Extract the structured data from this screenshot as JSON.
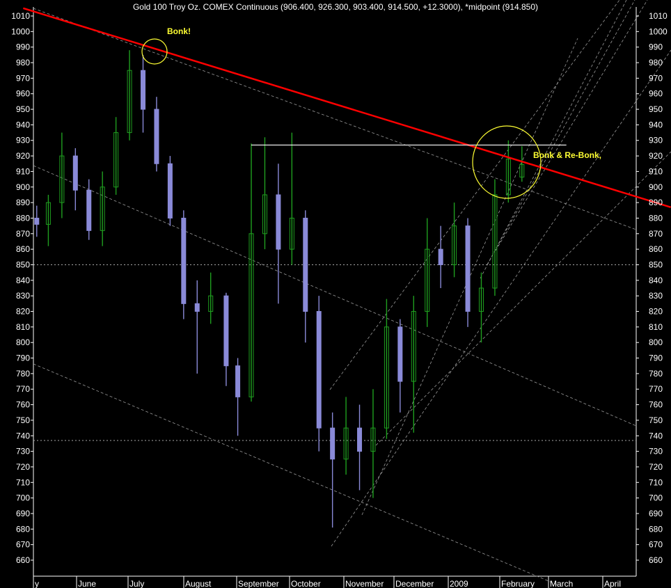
{
  "chart_data": {
    "type": "candlestick",
    "title": "Gold 100 Troy Oz. COMEX Continuous (906.400, 926.300, 903.400, 914.500, +12.3000), *midpoint (914.850)",
    "ylim": [
      655,
      1015
    ],
    "y_ticks": [
      660,
      670,
      680,
      690,
      700,
      710,
      720,
      730,
      740,
      750,
      760,
      770,
      780,
      790,
      800,
      810,
      820,
      830,
      840,
      850,
      860,
      870,
      880,
      890,
      900,
      910,
      920,
      930,
      940,
      950,
      960,
      970,
      980,
      990,
      1000,
      1010
    ],
    "x_ticks": [
      "y",
      "June",
      "July",
      "August",
      "September",
      "October",
      "November",
      "December",
      "2009",
      "February",
      "March",
      "April"
    ],
    "up_color": "#1f9e1f",
    "down_color": "#8a8ad8",
    "series": [
      {
        "date": "2008-05-27",
        "open": 880,
        "high": 888,
        "low": 868,
        "close": 876
      },
      {
        "date": "2008-06-02",
        "open": 876,
        "high": 895,
        "low": 862,
        "close": 890
      },
      {
        "date": "2008-06-09",
        "open": 890,
        "high": 935,
        "low": 880,
        "close": 920
      },
      {
        "date": "2008-06-16",
        "open": 920,
        "high": 925,
        "low": 885,
        "close": 898
      },
      {
        "date": "2008-06-23",
        "open": 898,
        "high": 905,
        "low": 866,
        "close": 872
      },
      {
        "date": "2008-06-30",
        "open": 872,
        "high": 910,
        "low": 862,
        "close": 900
      },
      {
        "date": "2008-07-07",
        "open": 900,
        "high": 945,
        "low": 895,
        "close": 935
      },
      {
        "date": "2008-07-14",
        "open": 935,
        "high": 988,
        "low": 930,
        "close": 975
      },
      {
        "date": "2008-07-21",
        "open": 975,
        "high": 985,
        "low": 935,
        "close": 950
      },
      {
        "date": "2008-07-28",
        "open": 950,
        "high": 958,
        "low": 910,
        "close": 915
      },
      {
        "date": "2008-08-04",
        "open": 915,
        "high": 920,
        "low": 875,
        "close": 880
      },
      {
        "date": "2008-08-11",
        "open": 880,
        "high": 885,
        "low": 815,
        "close": 825
      },
      {
        "date": "2008-08-18",
        "open": 825,
        "high": 840,
        "low": 780,
        "close": 820
      },
      {
        "date": "2008-08-25",
        "open": 820,
        "high": 845,
        "low": 812,
        "close": 830
      },
      {
        "date": "2008-09-02",
        "open": 830,
        "high": 832,
        "low": 772,
        "close": 785
      },
      {
        "date": "2008-09-08",
        "open": 785,
        "high": 790,
        "low": 740,
        "close": 765
      },
      {
        "date": "2008-09-15",
        "open": 765,
        "high": 928,
        "low": 762,
        "close": 870
      },
      {
        "date": "2008-09-22",
        "open": 870,
        "high": 932,
        "low": 860,
        "close": 895
      },
      {
        "date": "2008-09-29",
        "open": 895,
        "high": 915,
        "low": 825,
        "close": 860
      },
      {
        "date": "2008-10-06",
        "open": 860,
        "high": 935,
        "low": 850,
        "close": 880
      },
      {
        "date": "2008-10-13",
        "open": 880,
        "high": 885,
        "low": 800,
        "close": 820
      },
      {
        "date": "2008-10-20",
        "open": 820,
        "high": 830,
        "low": 730,
        "close": 745
      },
      {
        "date": "2008-10-27",
        "open": 745,
        "high": 755,
        "low": 681,
        "close": 725
      },
      {
        "date": "2008-11-03",
        "open": 725,
        "high": 765,
        "low": 715,
        "close": 745
      },
      {
        "date": "2008-11-10",
        "open": 745,
        "high": 760,
        "low": 705,
        "close": 730
      },
      {
        "date": "2008-11-17",
        "open": 730,
        "high": 770,
        "low": 700,
        "close": 745
      },
      {
        "date": "2008-11-24",
        "open": 745,
        "high": 828,
        "low": 738,
        "close": 810
      },
      {
        "date": "2008-12-01",
        "open": 810,
        "high": 815,
        "low": 755,
        "close": 775
      },
      {
        "date": "2008-12-08",
        "open": 775,
        "high": 830,
        "low": 742,
        "close": 820
      },
      {
        "date": "2008-12-15",
        "open": 820,
        "high": 880,
        "low": 810,
        "close": 860
      },
      {
        "date": "2008-12-22",
        "open": 860,
        "high": 875,
        "low": 835,
        "close": 850
      },
      {
        "date": "2008-12-29",
        "open": 850,
        "high": 890,
        "low": 842,
        "close": 875
      },
      {
        "date": "2009-01-05",
        "open": 875,
        "high": 880,
        "low": 810,
        "close": 820
      },
      {
        "date": "2009-01-12",
        "open": 820,
        "high": 845,
        "low": 800,
        "close": 835
      },
      {
        "date": "2009-01-19",
        "open": 835,
        "high": 905,
        "low": 830,
        "close": 895
      },
      {
        "date": "2009-01-26",
        "open": 895,
        "high": 930,
        "low": 890,
        "close": 918
      },
      {
        "date": "2009-02-02",
        "open": 906.4,
        "high": 926.3,
        "low": 903.4,
        "close": 914.5
      }
    ],
    "reference_lines": [
      {
        "type": "trendline",
        "color": "#ff0000",
        "from": {
          "date": "2008-05-20",
          "value": 1015
        },
        "to": {
          "date": "2009-04-20",
          "value": 887
        }
      },
      {
        "type": "horizontal",
        "color": "#ffffff",
        "value": 927,
        "from_date": "2008-09-15",
        "to_date": "2009-02-25"
      },
      {
        "type": "horizontal",
        "color": "#aaaaaa",
        "style": "dotted",
        "value": 850
      },
      {
        "type": "horizontal",
        "color": "#aaaaaa",
        "style": "dotted",
        "value": 737
      }
    ]
  },
  "annotations": {
    "bonk": "Bonk!",
    "rebonk": "Bonk & Re-Bonk,"
  }
}
